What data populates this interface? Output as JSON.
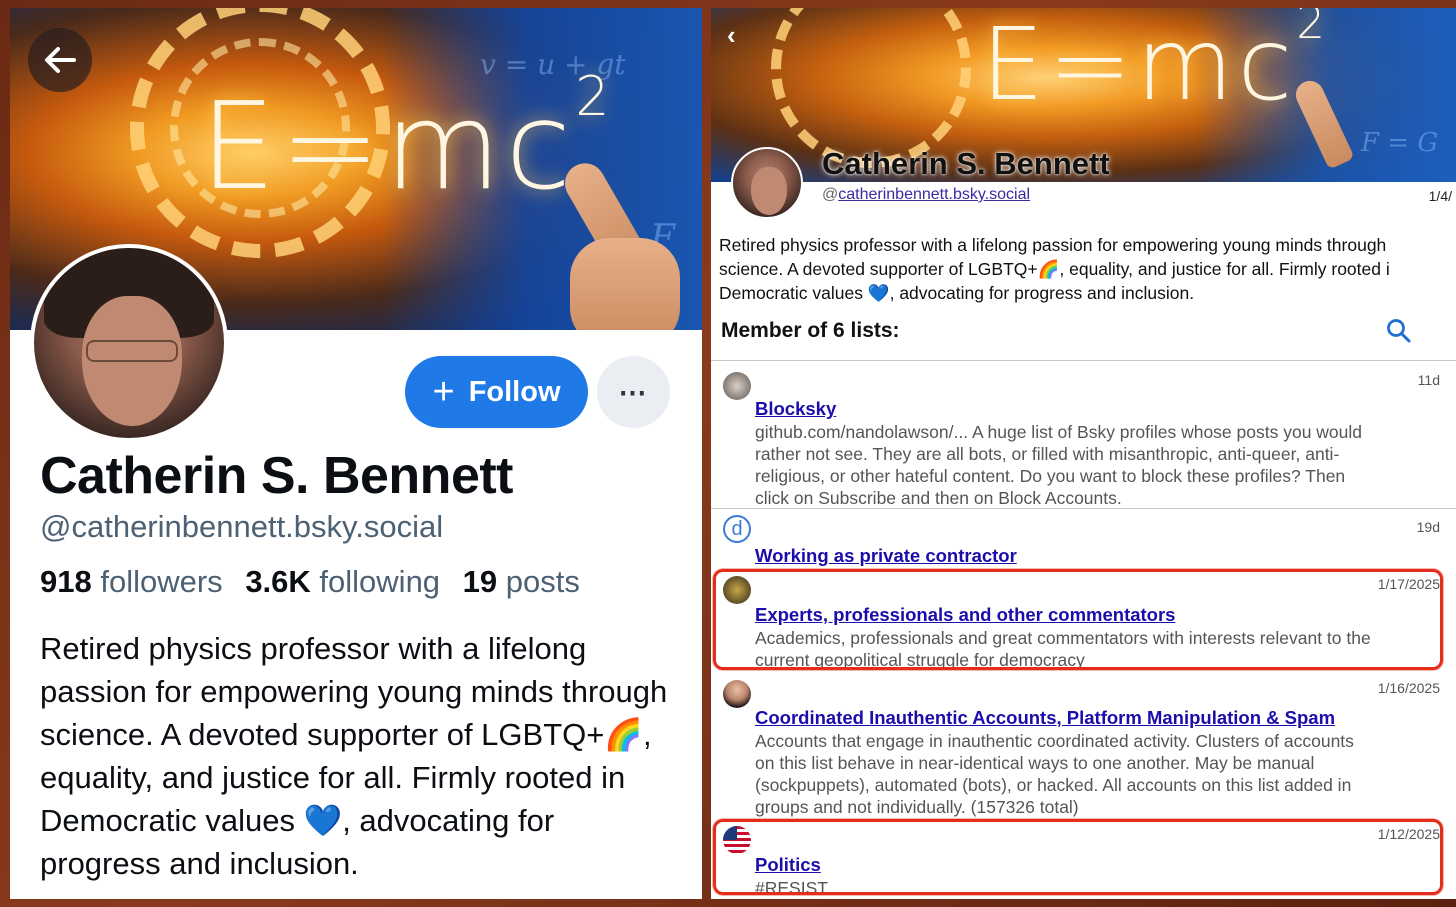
{
  "left_profile": {
    "back_icon": "arrow-left-icon",
    "banner_formula": "E=mc",
    "banner_formula_sup": "2",
    "follow_label": "Follow",
    "more_label": "⋯",
    "name": "Catherin S. Bennett",
    "handle": "@catherinbennett.bsky.social",
    "stats": {
      "followers_count": "918",
      "followers_label": "followers",
      "following_count": "3.6K",
      "following_label": "following",
      "posts_count": "19",
      "posts_label": "posts"
    },
    "bio": "Retired physics professor with a lifelong passion for empowering young minds through science. A devoted supporter of LGBTQ+🌈, equality, and justice for all. Firmly rooted in Democratic values 💙, advocating for progress and inclusion."
  },
  "right_profile": {
    "back_label": "‹",
    "name": "Catherin S. Bennett",
    "handle_prefix": "@",
    "handle_link": "catherinbennett.bsky.social",
    "date": "1/4/",
    "bio_lines": [
      "Retired physics professor with a lifelong passion for empowering young minds through",
      "science. A devoted supporter of LGBTQ+🌈, equality, and justice for all. Firmly rooted i",
      "Democratic values 💙, advocating for progress and inclusion."
    ],
    "member_of": "Member of 6 lists:",
    "search_icon": "search-icon",
    "lists": [
      {
        "icon": "list-avatar-blocksky",
        "date": "11d",
        "title": "Blocksky",
        "desc_lines": [
          "github.com/nandolawson/... A huge list of Bsky profiles whose posts you would",
          "rather not see. They are all bots, or filled with misanthropic, anti-queer, anti-",
          "religious, or other hateful content. Do you want to block these profiles? Then",
          "click on Subscribe and then on Block Accounts."
        ]
      },
      {
        "icon": "list-avatar-d",
        "icon_letter": "d",
        "date": "19d",
        "title": "Working as private contractor",
        "desc_lines": []
      },
      {
        "icon": "list-avatar-experts",
        "date": "1/17/2025",
        "title": "Experts, professionals and other commentators",
        "desc_lines": [
          "Academics, professionals and great commentators with interests relevant to the",
          "current geopolitical struggle for democracy"
        ]
      },
      {
        "icon": "list-avatar-woman",
        "date": "1/16/2025",
        "title": "Coordinated Inauthentic Accounts, Platform Manipulation & Spam",
        "desc_lines": [
          "Accounts that engage in inauthentic coordinated activity. Clusters of accounts",
          "on this list behave in near-identical ways to one another. May be manual",
          "(sockpuppets), automated (bots), or hacked. All accounts on this list added in",
          "groups and not individually. (157326 total)"
        ]
      },
      {
        "icon": "list-avatar-flag",
        "date": "1/12/2025",
        "title": "Politics",
        "desc_lines": [
          "#RESIST"
        ]
      }
    ]
  },
  "colors": {
    "follow_button": "#1f7ae8",
    "link": "#1a0dab",
    "highlight": "#e52d1c",
    "background": "#6b2a14"
  }
}
